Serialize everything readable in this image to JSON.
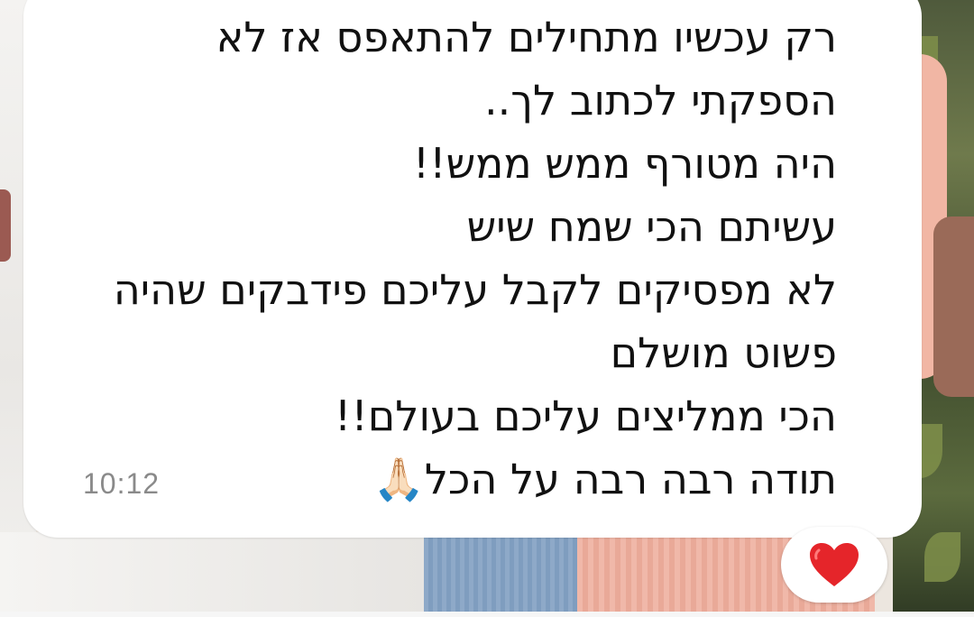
{
  "message": {
    "lines": [
      "רק עכשיו מתחילים להתאפס אז לא",
      "הספקתי לכתוב לך..",
      "היה מטורף ממש ממש!!",
      "עשיתם הכי שמח שיש",
      "לא מפסיקים לקבל עליכם פידבקים שהיה",
      "פשוט מושלם",
      "הכי ממליצים עליכם בעולם!!",
      "תודה רבה רבה על הכל🙏🏻"
    ],
    "time": "10:12"
  },
  "reaction": {
    "icon": "red-heart-icon",
    "color": "#e5252a"
  },
  "colors": {
    "bubble": "#ffffff",
    "text": "#111111",
    "time": "#8a8a8a"
  }
}
